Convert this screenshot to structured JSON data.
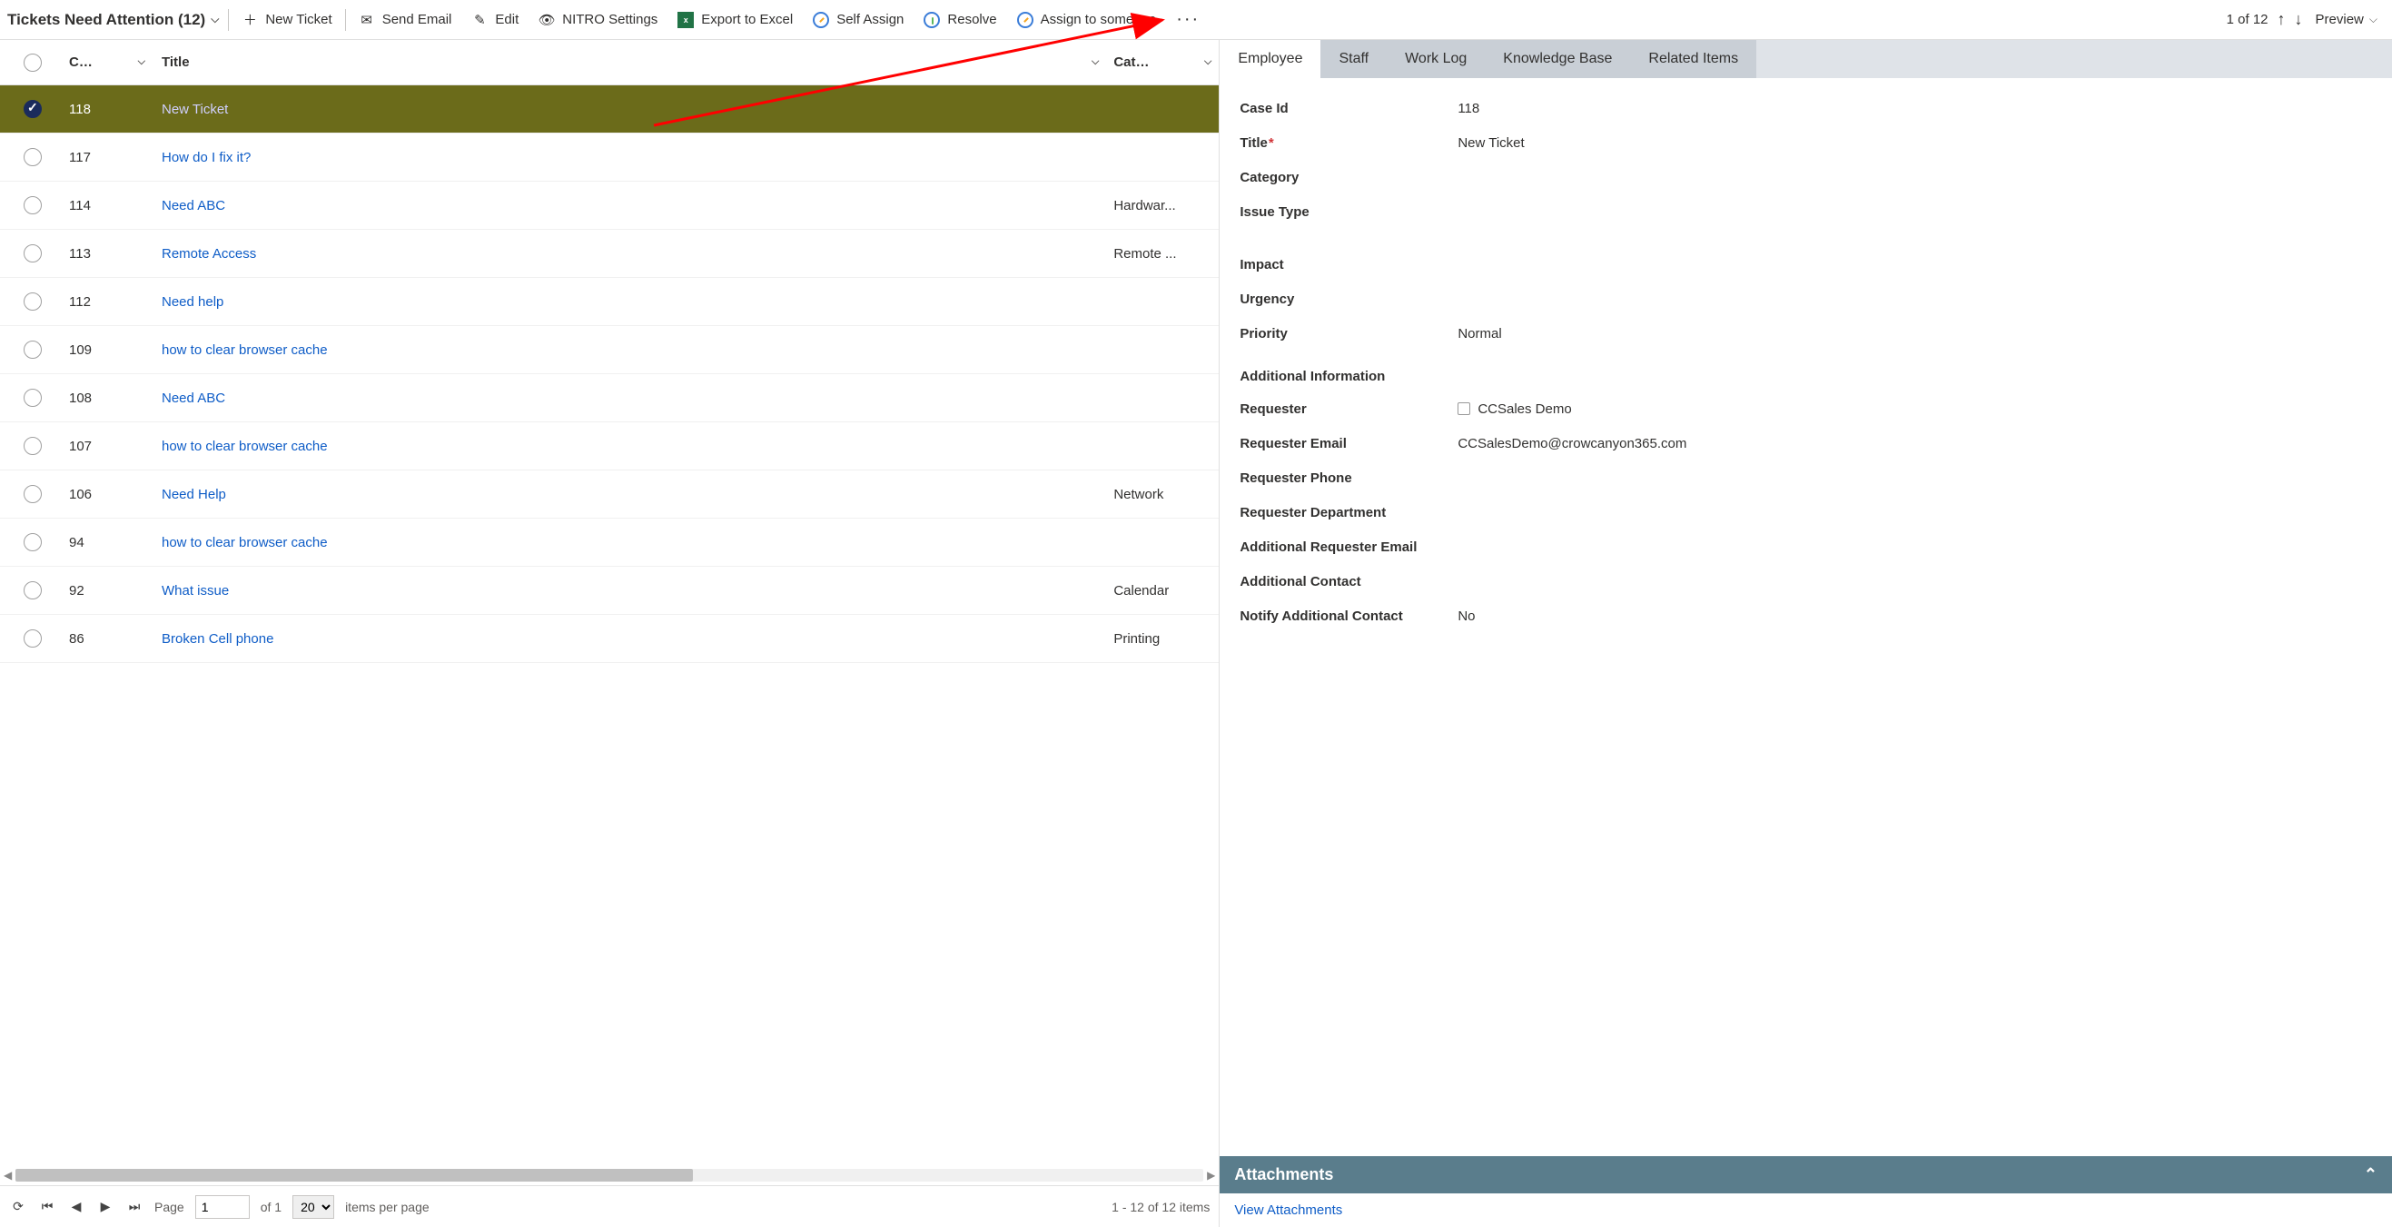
{
  "toolbar": {
    "view_title": "Tickets Need Attention (12)",
    "new_ticket": "New Ticket",
    "send_email": "Send Email",
    "edit": "Edit",
    "nitro": "NITRO Settings",
    "export": "Export to Excel",
    "self_assign": "Self Assign",
    "resolve": "Resolve",
    "assign_someone": "Assign to someone",
    "counter": "1 of 12",
    "preview": "Preview"
  },
  "grid": {
    "headers": {
      "case": "C…",
      "title": "Title",
      "category": "Cat…"
    },
    "rows": [
      {
        "case": "118",
        "title": "New Ticket",
        "category": "",
        "selected": true
      },
      {
        "case": "117",
        "title": "How do I fix it?",
        "category": ""
      },
      {
        "case": "114",
        "title": "Need ABC",
        "category": "Hardwar..."
      },
      {
        "case": "113",
        "title": "Remote Access",
        "category": "Remote ..."
      },
      {
        "case": "112",
        "title": "Need help",
        "category": ""
      },
      {
        "case": "109",
        "title": "how to clear browser cache",
        "category": ""
      },
      {
        "case": "108",
        "title": "Need ABC",
        "category": ""
      },
      {
        "case": "107",
        "title": "how to clear browser cache",
        "category": ""
      },
      {
        "case": "106",
        "title": "Need Help",
        "category": "Network"
      },
      {
        "case": "94",
        "title": "how to clear browser cache",
        "category": ""
      },
      {
        "case": "92",
        "title": "What issue",
        "category": "Calendar"
      },
      {
        "case": "86",
        "title": "Broken Cell phone",
        "category": "Printing"
      }
    ]
  },
  "pager": {
    "page_label": "Page",
    "page_value": "1",
    "of_label": "of 1",
    "page_size": "20",
    "ipp": "items per page",
    "range": "1 - 12 of 12 items"
  },
  "tabs": [
    "Employee",
    "Staff",
    "Work Log",
    "Knowledge Base",
    "Related Items"
  ],
  "details": {
    "fields_basic": [
      {
        "label": "Case Id",
        "value": "118"
      },
      {
        "label": "Title",
        "value": "New Ticket",
        "required": true
      },
      {
        "label": "Category",
        "value": ""
      },
      {
        "label": "Issue Type",
        "value": ""
      }
    ],
    "impact_label": "Impact",
    "urgency_label": "Urgency",
    "priority_label": "Priority",
    "priority_value": "Normal",
    "addl_info_header": "Additional Information",
    "fields_addl": [
      {
        "label": "Requester",
        "value": "CCSales Demo",
        "usericon": true
      },
      {
        "label": "Requester Email",
        "value": "CCSalesDemo@crowcanyon365.com"
      },
      {
        "label": "Requester Phone",
        "value": ""
      },
      {
        "label": "Requester Department",
        "value": ""
      },
      {
        "label": "Additional Requester Email",
        "value": ""
      },
      {
        "label": "Additional Contact",
        "value": ""
      },
      {
        "label": "Notify Additional Contact",
        "value": "No"
      }
    ]
  },
  "attachments": {
    "header": "Attachments",
    "link": "View Attachments"
  }
}
